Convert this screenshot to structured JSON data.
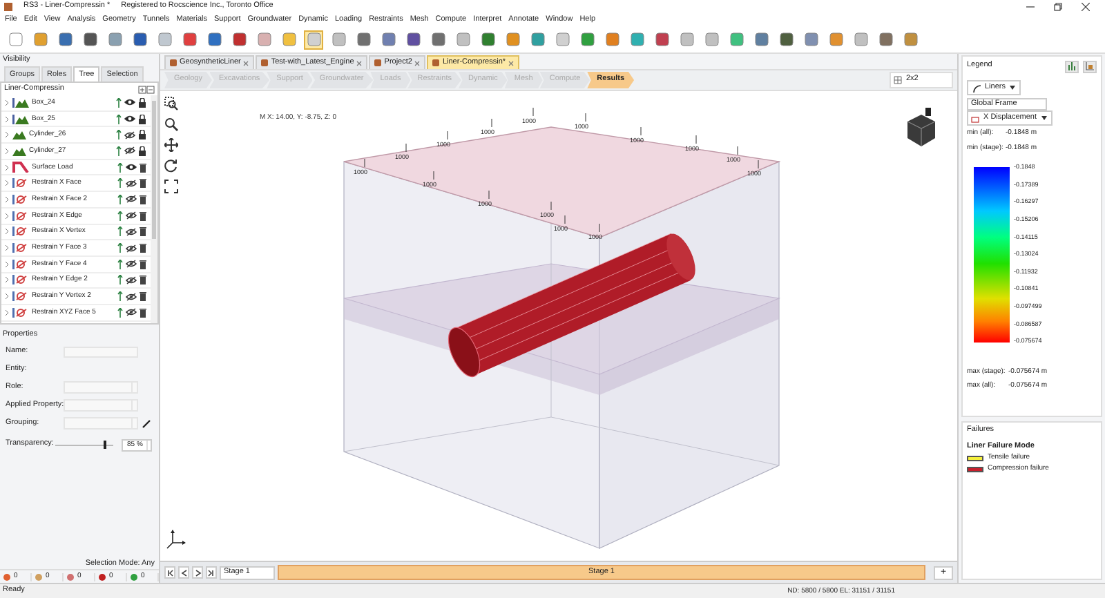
{
  "window": {
    "title": "RS3 - Liner-Compressin *",
    "registration": "Registered to Rocscience Inc., Toronto Office"
  },
  "menu": [
    "File",
    "Edit",
    "View",
    "Analysis",
    "Geometry",
    "Tunnels",
    "Materials",
    "Support",
    "Groundwater",
    "Dynamic",
    "Loading",
    "Restraints",
    "Mesh",
    "Compute",
    "Interpret",
    "Annotate",
    "Window",
    "Help"
  ],
  "visibility": {
    "title": "Visibility",
    "tabs": [
      {
        "label": "Groups",
        "selected": false
      },
      {
        "label": "Roles",
        "selected": false
      },
      {
        "label": "Tree",
        "selected": true
      },
      {
        "label": "Selection",
        "selected": false
      }
    ],
    "tree_title": "Liner-Compressin",
    "items": [
      {
        "label": "Box_24",
        "kind": "box",
        "visible": true,
        "locked": true
      },
      {
        "label": "Box_25",
        "kind": "box",
        "visible": true,
        "locked": true
      },
      {
        "label": "Cylinder_26",
        "kind": "cylinder",
        "visible": false,
        "locked": true
      },
      {
        "label": "Cylinder_27",
        "kind": "cylinder",
        "visible": false,
        "locked": true
      },
      {
        "label": "Surface Load",
        "kind": "load",
        "visible": true,
        "locked": false
      },
      {
        "label": "Restrain X Face",
        "kind": "restraint",
        "visible": false,
        "locked": false
      },
      {
        "label": "Restrain X Face 2",
        "kind": "restraint",
        "visible": false,
        "locked": false
      },
      {
        "label": "Restrain X Edge",
        "kind": "restraint",
        "visible": false,
        "locked": false
      },
      {
        "label": "Restrain X Vertex",
        "kind": "restraint",
        "visible": false,
        "locked": false
      },
      {
        "label": "Restrain Y Face 3",
        "kind": "restraint",
        "visible": false,
        "locked": false
      },
      {
        "label": "Restrain Y Face 4",
        "kind": "restraint",
        "visible": false,
        "locked": false
      },
      {
        "label": "Restrain Y Edge 2",
        "kind": "restraint",
        "visible": false,
        "locked": false
      },
      {
        "label": "Restrain Y Vertex 2",
        "kind": "restraint",
        "visible": false,
        "locked": false
      },
      {
        "label": "Restrain XYZ Face 5",
        "kind": "restraint",
        "visible": false,
        "locked": false
      }
    ]
  },
  "properties": {
    "title": "Properties",
    "fields": [
      {
        "label": "Name:",
        "kind": "text"
      },
      {
        "label": "Entity:",
        "kind": "none"
      },
      {
        "label": "Role:",
        "kind": "combo"
      },
      {
        "label": "Applied Property:",
        "kind": "combo"
      },
      {
        "label": "Grouping:",
        "kind": "combo_edit"
      }
    ],
    "transparency": {
      "label": "Transparency:",
      "level": 0.85,
      "value": "85 %"
    },
    "selection_mode": "Selection Mode: Any",
    "counters": [
      "0",
      "0",
      "0",
      "0",
      "0"
    ]
  },
  "documents": [
    {
      "label": "GeosyntheticLiner",
      "selected": false
    },
    {
      "label": "Test-with_Latest_Engine",
      "selected": false
    },
    {
      "label": "Project2",
      "selected": false
    },
    {
      "label": "Liner-Compressin*",
      "selected": true
    }
  ],
  "workflow": [
    {
      "label": "Geology",
      "selected": false
    },
    {
      "label": "Excavations",
      "selected": false
    },
    {
      "label": "Support",
      "selected": false
    },
    {
      "label": "Groundwater",
      "selected": false
    },
    {
      "label": "Loads",
      "selected": false
    },
    {
      "label": "Restraints",
      "selected": false
    },
    {
      "label": "Dynamic",
      "selected": false
    },
    {
      "label": "Mesh",
      "selected": false
    },
    {
      "label": "Compute",
      "selected": false
    },
    {
      "label": "Results",
      "selected": true
    }
  ],
  "layout_selector": "2x2",
  "viewport": {
    "coordinates": "M X: 14.00, Y: -8.75, Z: 0",
    "load_labels": [
      "1000",
      "1000",
      "1000",
      "1000",
      "1000",
      "1000",
      "1000",
      "1000",
      "1000",
      "1000",
      "1000",
      "1000",
      "1000",
      "1000",
      "1000"
    ]
  },
  "stage_bar": {
    "stage_dropdown": "Stage 1",
    "stage": "Stage 1",
    "add": "+"
  },
  "legend": {
    "title": "Legend",
    "liners": "Liners",
    "frame": "Global Frame",
    "quantity": "X Displacement",
    "min_rows": [
      {
        "label": "min (all):",
        "value": "-0.1848 m"
      },
      {
        "label": "min (stage):",
        "value": "-0.1848 m"
      }
    ],
    "ticks": [
      "-0.1848",
      "-0.17389",
      "-0.16297",
      "-0.15206",
      "-0.14115",
      "-0.13024",
      "-0.11932",
      "-0.10841",
      "-0.097499",
      "-0.086587",
      "-0.075674"
    ],
    "max_rows": [
      {
        "label": "max (stage):",
        "value": "-0.075674 m"
      },
      {
        "label": "max (all):",
        "value": "-0.075674 m"
      }
    ]
  },
  "failures": {
    "title": "Failures",
    "heading": "Liner Failure Mode",
    "items": [
      {
        "label": "Tensile failure",
        "color": "#f5f03c"
      },
      {
        "label": "Compression failure",
        "color": "#c8202c"
      }
    ]
  },
  "status_bar": {
    "left": "Ready",
    "right": "ND: 5800 / 5800   EL: 31151 / 31151"
  }
}
